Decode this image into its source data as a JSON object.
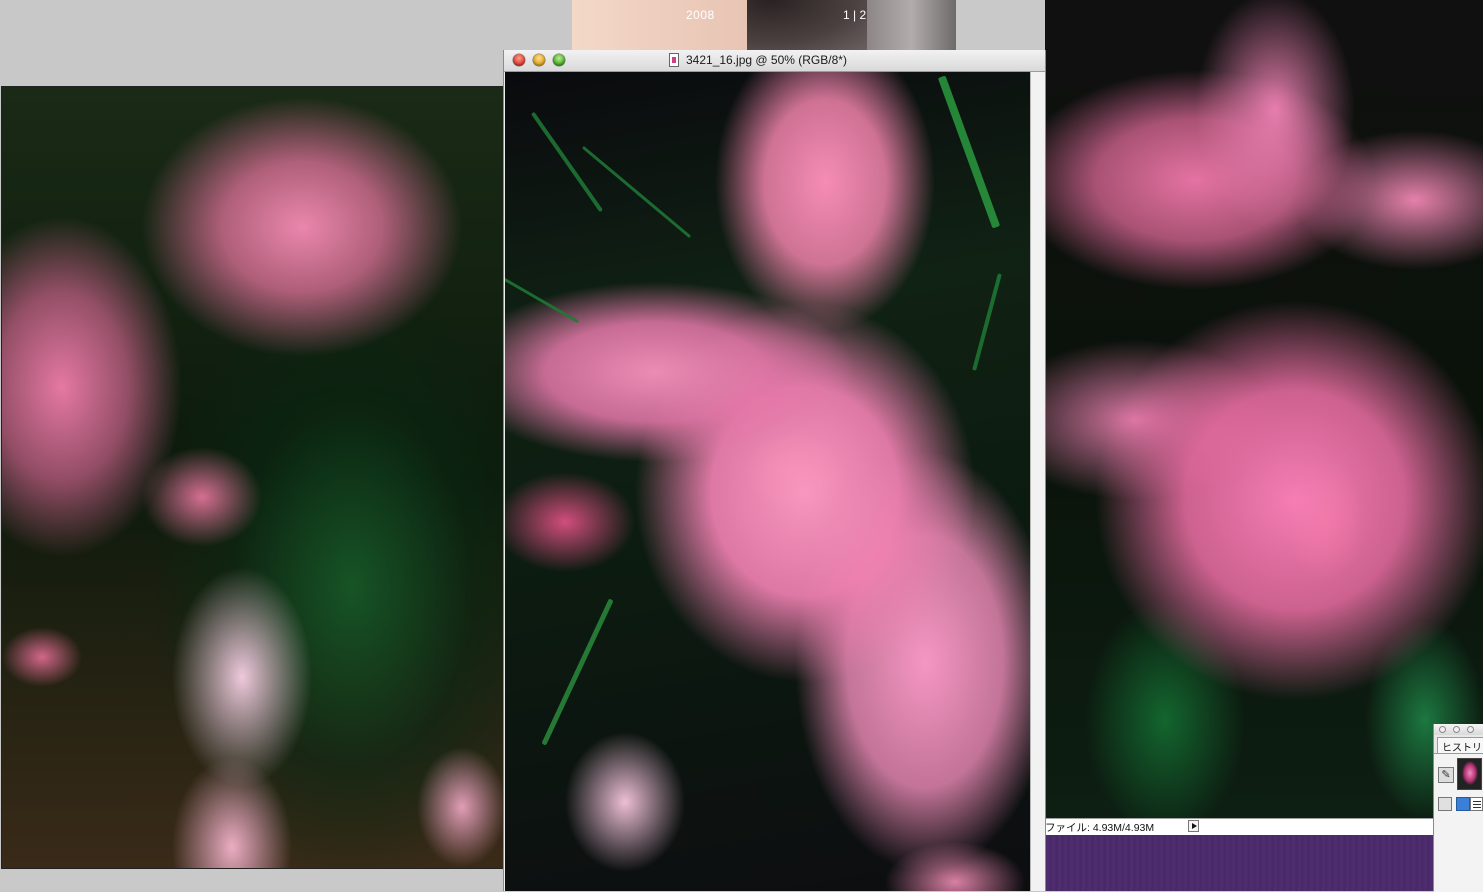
{
  "background_document": {
    "year_text": "2008",
    "page_numbers": "1 | 2"
  },
  "document_window": {
    "title": "3421_16.jpg @ 50% (RGB/8*)"
  },
  "info_bar": {
    "file_size": "ファイル: 4.93M/4.93M"
  },
  "history_palette": {
    "tab_label": "ヒストリー"
  },
  "colors": {
    "close_button": "#d8362a",
    "minimize_button": "#d99b14",
    "zoom_button": "#3fa223"
  }
}
